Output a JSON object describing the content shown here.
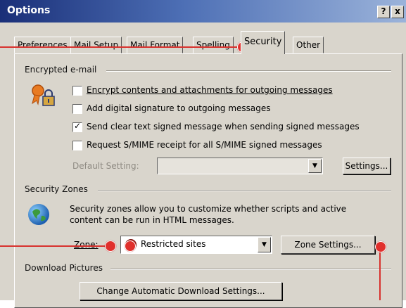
{
  "window": {
    "title": "Options",
    "help_label": "?",
    "close_label": "x"
  },
  "tabs": [
    {
      "label": "Preferences"
    },
    {
      "label": "Mail Setup"
    },
    {
      "label": "Mail Format"
    },
    {
      "label": "Spelling"
    },
    {
      "label": "Security",
      "active": true
    },
    {
      "label": "Other"
    }
  ],
  "encrypted": {
    "heading": "Encrypted e-mail",
    "icon": "certificate-lock-icon",
    "options": [
      {
        "label": "Encrypt contents and attachments for outgoing messages",
        "checked": false
      },
      {
        "label": "Add digital signature to outgoing messages",
        "checked": false
      },
      {
        "label": "Send clear text signed message when sending signed messages",
        "checked": true
      },
      {
        "label": "Request S/MIME receipt for all S/MIME signed messages",
        "checked": false
      }
    ],
    "default_setting_label": "Default Setting:",
    "default_setting_value": "",
    "settings_button": "Settings..."
  },
  "zones": {
    "heading": "Security Zones",
    "icon": "globe-icon",
    "description_line1": "Security zones allow you to customize whether scripts and active",
    "description_line2": "content can be run in HTML messages.",
    "zone_label": "Zone:",
    "zone_value": "Restricted sites",
    "zone_value_icon": "restricted-sites-icon",
    "zone_settings_button": "Zone Settings..."
  },
  "download": {
    "heading": "Download Pictures",
    "change_button": "Change Automatic Download Settings..."
  },
  "colors": {
    "callout": "#e0302c",
    "titlebar": "#1a2f78",
    "dialog": "#d9d5cc"
  }
}
